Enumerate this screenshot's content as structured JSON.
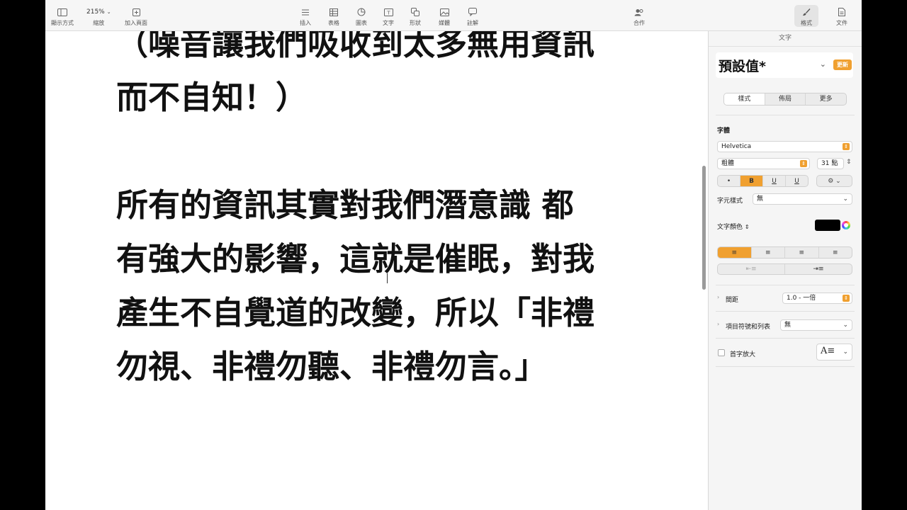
{
  "toolbar": {
    "view_label": "顯示方式",
    "zoom_value": "215%",
    "zoom_label": "縮放",
    "add_page_label": "加入頁面",
    "insert_label": "插入",
    "table_label": "表格",
    "chart_label": "圖表",
    "text_label": "文字",
    "shape_label": "形狀",
    "media_label": "媒體",
    "comment_label": "註解",
    "collaborate_label": "合作",
    "format_label": "格式",
    "document_label": "文件"
  },
  "document": {
    "lines": [
      "（噪音讓我們吸收到太多無用資訊",
      "而不自知！）",
      "",
      "所有的資訊其實對我們潛意識 都",
      "有強大的影響，這就是催眠，對我",
      "產生不自覺道的改變，所以「非禮",
      "勿視、非禮勿聽、非禮勿言。」"
    ]
  },
  "sidebar": {
    "header": "文字",
    "paragraph_style": "預設值*",
    "update_button": "更新",
    "tabs": [
      "樣式",
      "佈局",
      "更多"
    ],
    "font_section": "字體",
    "font_name": "Helvetica",
    "font_weight": "粗體",
    "font_size": "31 點",
    "bold_glyph": "B",
    "italic_glyph": "U",
    "underline_glyph": "U",
    "char_style_label": "字元樣式",
    "char_style_value": "無",
    "text_color_label": "文字顏色",
    "text_color": "#000000",
    "spacing_label": "間距",
    "spacing_value": "1.0 - 一倍",
    "bullets_label": "項目符號和列表",
    "bullets_value": "無",
    "drop_cap_label": "首字放大"
  },
  "colors": {
    "accent": "#f0a030"
  }
}
